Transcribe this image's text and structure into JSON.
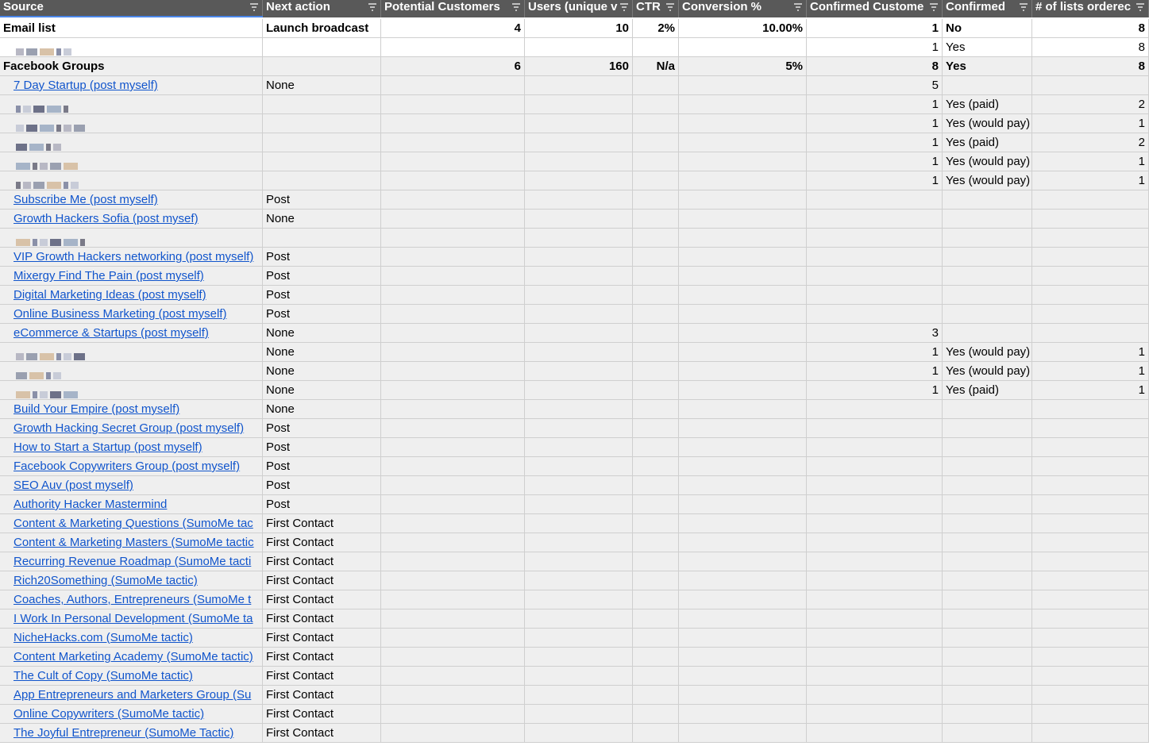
{
  "columns": [
    {
      "label": "Source"
    },
    {
      "label": "Next action"
    },
    {
      "label": "Potential Customers"
    },
    {
      "label": "Users (unique v"
    },
    {
      "label": "CTR"
    },
    {
      "label": "Conversion %"
    },
    {
      "label": "Confirmed Custome"
    },
    {
      "label": "Confirmed"
    },
    {
      "label": "# of lists orderec"
    }
  ],
  "rows": [
    {
      "type": "summary",
      "source": "Email list",
      "next": "Launch broadcast",
      "potential": "4",
      "users": "10",
      "ctr": "2%",
      "conv": "10.00%",
      "cc": "1",
      "confirmed": "No",
      "lists": "8"
    },
    {
      "type": "redacted",
      "source": "",
      "next": "",
      "cc": "1",
      "confirmed": "Yes",
      "lists": "8"
    },
    {
      "type": "summary",
      "source": "Facebook Groups",
      "next": "",
      "potential": "6",
      "users": "160",
      "ctr": "N/a",
      "conv": "5%",
      "cc": "8",
      "confirmed": "Yes",
      "lists": "8"
    },
    {
      "type": "link",
      "source": "7 Day Startup (post myself)",
      "next": "None",
      "cc": "5"
    },
    {
      "type": "redacted",
      "cc": "1",
      "confirmed": "Yes (paid)",
      "lists": "2"
    },
    {
      "type": "redacted",
      "cc": "1",
      "confirmed": "Yes (would pay)",
      "lists": "1"
    },
    {
      "type": "redacted",
      "cc": "1",
      "confirmed": "Yes (paid)",
      "lists": "2"
    },
    {
      "type": "redacted",
      "cc": "1",
      "confirmed": "Yes (would pay)",
      "lists": "1"
    },
    {
      "type": "redacted",
      "cc": "1",
      "confirmed": "Yes (would pay)",
      "lists": "1"
    },
    {
      "type": "link",
      "source": "Subscribe Me (post myself)",
      "next": "Post"
    },
    {
      "type": "link",
      "source": "Growth Hackers Sofia (post mysef)",
      "next": "None"
    },
    {
      "type": "redacted"
    },
    {
      "type": "link",
      "source": "VIP Growth Hackers networking (post myself)",
      "next": "Post"
    },
    {
      "type": "link",
      "source": "Mixergy Find The Pain (post myself)",
      "next": "Post"
    },
    {
      "type": "link",
      "source": "Digital Marketing Ideas (post myself)",
      "next": "Post"
    },
    {
      "type": "link",
      "source": "Online Business Marketing (post myself)",
      "next": "Post"
    },
    {
      "type": "link",
      "source": "eCommerce & Startups (post myself)",
      "next": "None",
      "cc": "3"
    },
    {
      "type": "redacted",
      "next": "None",
      "cc": "1",
      "confirmed": "Yes (would pay)",
      "lists": "1"
    },
    {
      "type": "redacted",
      "next": "None",
      "cc": "1",
      "confirmed": "Yes (would pay)",
      "lists": "1"
    },
    {
      "type": "redacted",
      "next": "None",
      "cc": "1",
      "confirmed": "Yes (paid)",
      "lists": "1"
    },
    {
      "type": "link",
      "source": "Build Your Empire (post myself)",
      "next": "None"
    },
    {
      "type": "link",
      "source": "Growth Hacking Secret Group (post myself)",
      "next": "Post"
    },
    {
      "type": "link",
      "source": "How to Start a Startup (post myself)",
      "next": "Post"
    },
    {
      "type": "link",
      "source": "Facebook Copywriters Group (post myself)",
      "next": "Post"
    },
    {
      "type": "link",
      "source": "SEO Auv (post myself)",
      "next": "Post"
    },
    {
      "type": "link",
      "source": "Authority Hacker Mastermind",
      "next": "Post"
    },
    {
      "type": "link",
      "source": "Content & Marketing Questions (SumoMe tac",
      "next": "First Contact"
    },
    {
      "type": "link",
      "source": "Content & Marketing Masters (SumoMe tactic",
      "next": "First Contact"
    },
    {
      "type": "link",
      "source": "Recurring Revenue Roadmap (SumoMe tacti",
      "next": "First Contact"
    },
    {
      "type": "link",
      "source": "Rich20Something (SumoMe tactic)",
      "next": "First Contact"
    },
    {
      "type": "link",
      "source": "Coaches, Authors, Entrepreneurs (SumoMe t",
      "next": "First Contact"
    },
    {
      "type": "link",
      "source": "I Work In Personal Development (SumoMe ta",
      "next": "First Contact"
    },
    {
      "type": "link",
      "source": "NicheHacks.com (SumoMe tactic)",
      "next": "First Contact"
    },
    {
      "type": "link",
      "source": "Content Marketing Academy (SumoMe tactic)",
      "next": "First Contact"
    },
    {
      "type": "link",
      "source": "The Cult of Copy (SumoMe tactic)",
      "next": "First Contact"
    },
    {
      "type": "link",
      "source": "App Entrepreneurs and Marketers Group (Su",
      "next": "First Contact"
    },
    {
      "type": "link",
      "source": "Online Copywriters (SumoMe tactic)",
      "next": "First Contact"
    },
    {
      "type": "link",
      "source": "The Joyful Entrepreneur (SumoMe Tactic)",
      "next": "First Contact"
    }
  ],
  "colors": {
    "header_bg": "#595959",
    "row_bg": "#efefef",
    "link": "#1155cc",
    "selection": "#4a86e8"
  }
}
